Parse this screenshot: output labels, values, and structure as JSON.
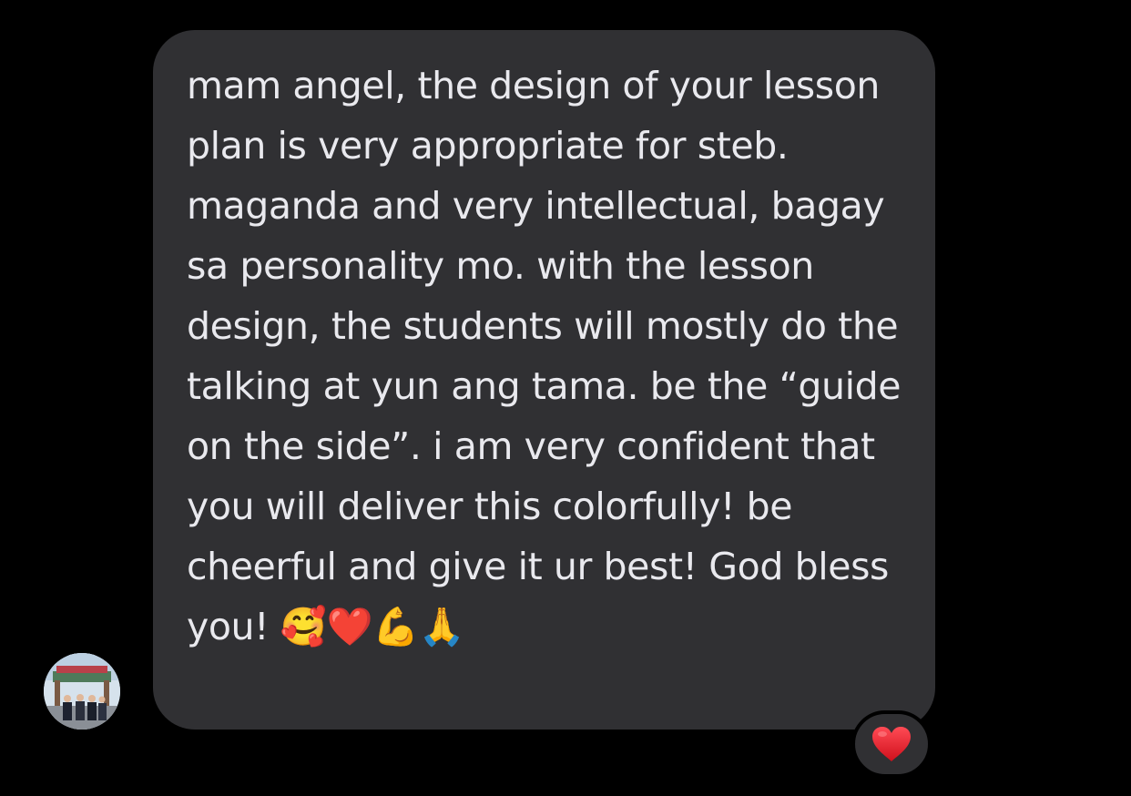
{
  "message": {
    "sender_avatar": "contact-avatar-photo",
    "text": "mam angel, the design of your lesson plan is very appropriate for steb. maganda and very intellectual, bagay sa personality mo. with the lesson design, the students will mostly do the talking at yun ang tama. be the “guide on the side”. i am very confident that you will deliver this colorfully! be cheerful and give it ur best! God bless you! 🥰❤️💪🙏",
    "bubble_color": "#303033",
    "text_color": "#e9e9ee"
  },
  "reaction": {
    "icon": "heart-icon",
    "color": "#e8232f"
  },
  "background_color": "#000000"
}
